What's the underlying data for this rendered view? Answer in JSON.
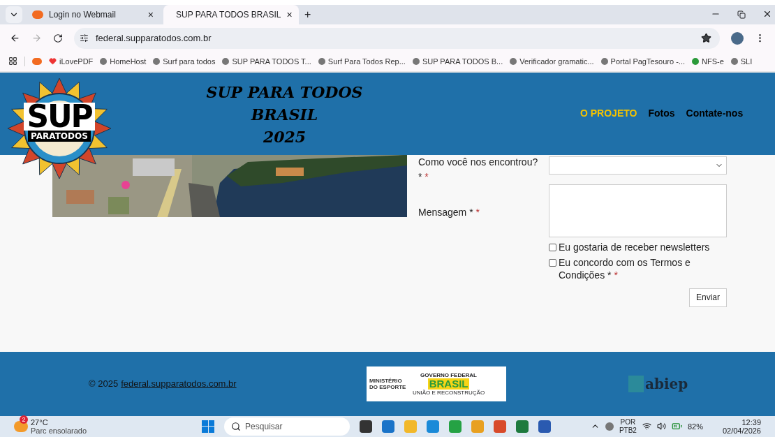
{
  "browser": {
    "tabs": [
      {
        "title": "Login no Webmail",
        "close": "×",
        "selected": false
      },
      {
        "title": "SUP PARA TODOS BRASIL",
        "close": "×",
        "selected": true
      }
    ],
    "new_tab": "+",
    "url": "federal.supparatodos.com.br",
    "bookmarks": [
      "iLovePDF",
      "HomeHost",
      "Surf para todos",
      "SUP PARA TODOS T...",
      "Surf Para Todos Rep...",
      "SUP PARA TODOS B...",
      "Verificador gramatic...",
      "Portal PagTesouro -...",
      "NFS-e",
      "SLI"
    ]
  },
  "header": {
    "logo": {
      "top": "SUP",
      "bottom": "PARATODOS"
    },
    "title_lines": [
      "SUP PARA TODOS",
      "BRASIL",
      "2025"
    ],
    "nav": [
      {
        "label": "O PROJETO",
        "selected": true
      },
      {
        "label": "Fotos",
        "selected": false
      },
      {
        "label": "Contate-nos",
        "selected": false
      }
    ]
  },
  "form": {
    "fields": [
      {
        "kind": "select",
        "label": "Como você nos encontrou?",
        "mark": "*",
        "required": "*"
      },
      {
        "kind": "textarea",
        "label": "Mensagem",
        "mark": "*",
        "required": "*"
      }
    ],
    "checkboxes": [
      {
        "label": "Eu gostaria de receber newsletters",
        "checked": false
      },
      {
        "label": "Eu concordo com os Termos e Condições",
        "checked": false,
        "mark": "*",
        "required": "*"
      }
    ],
    "submit": "Enviar"
  },
  "footer": {
    "copyright": "© 2025",
    "link": "federal.supparatodos.com.br",
    "gov_logo": {
      "ministry": "MINISTÉRIO DO ESPORTE",
      "top": "GOVERNO FEDERAL",
      "name": "BRASIL",
      "motto": "UNIÃO E RECONSTRUÇÃO"
    },
    "abiep": "abiep"
  },
  "taskbar": {
    "weather_badge": "2",
    "temperature": "27°C",
    "weather": "Parc ensolarado",
    "search": "Pesquisar",
    "lang": "POR",
    "layout": "PTB2",
    "battery": "82%",
    "time": "12:39",
    "date": "02/04/2026"
  }
}
